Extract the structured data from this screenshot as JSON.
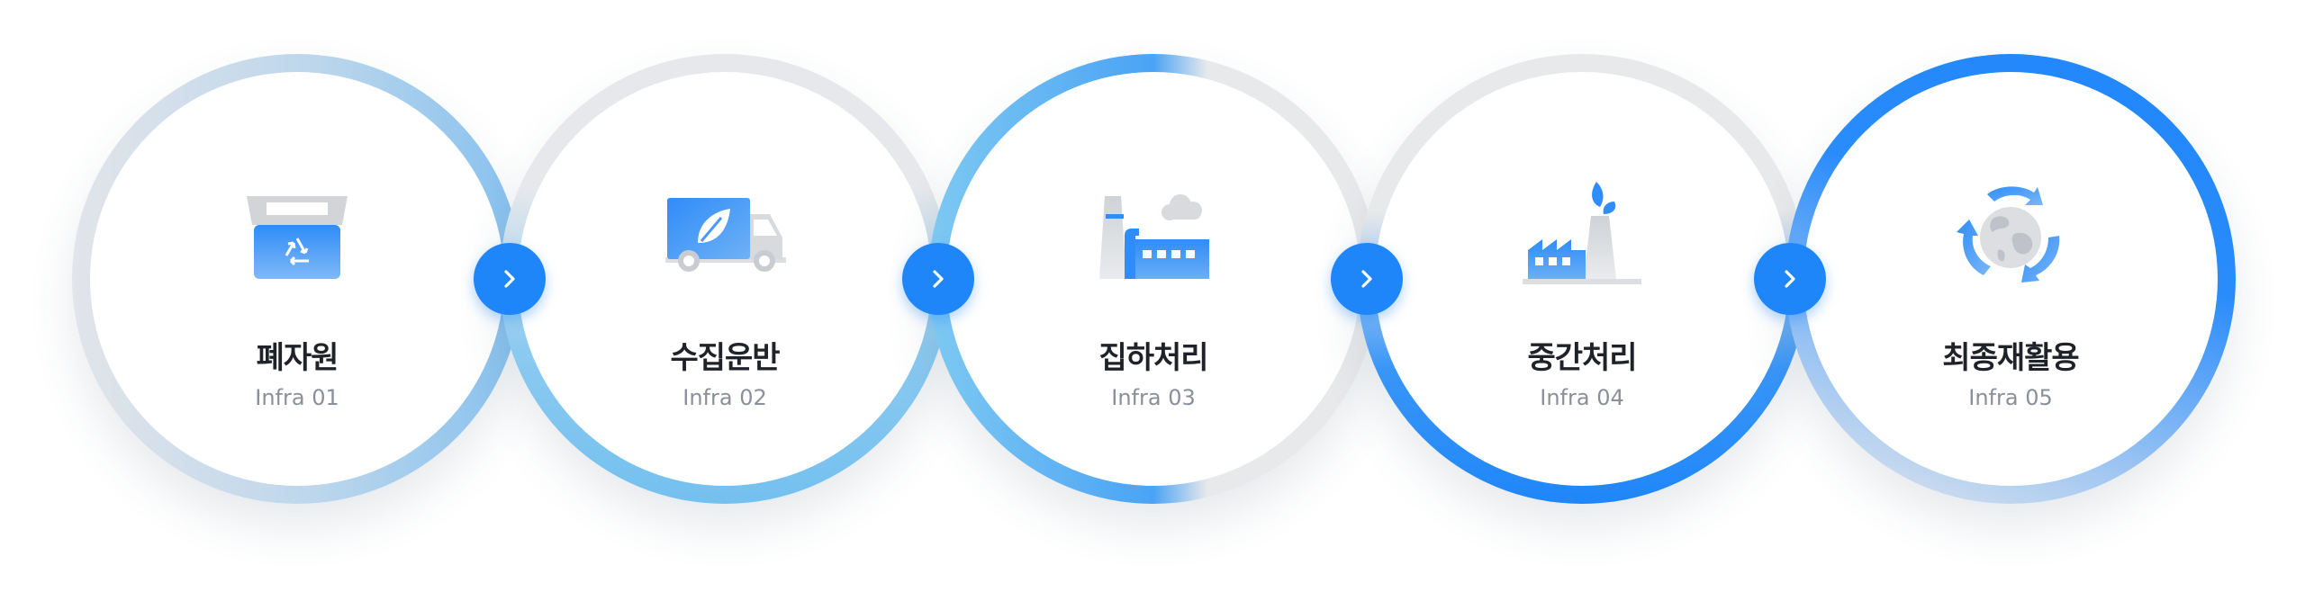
{
  "steps": [
    {
      "title": "폐자원",
      "subtitle": "Infra 01",
      "icon": "recycle-bin-icon"
    },
    {
      "title": "수집운반",
      "subtitle": "Infra 02",
      "icon": "truck-icon"
    },
    {
      "title": "집하처리",
      "subtitle": "Infra 03",
      "icon": "collection-plant-icon"
    },
    {
      "title": "중간처리",
      "subtitle": "Infra 04",
      "icon": "eco-factory-icon"
    },
    {
      "title": "최종재활용",
      "subtitle": "Infra 05",
      "icon": "globe-recycle-icon"
    }
  ],
  "arrows": [
    "chevron-right-icon",
    "chevron-right-icon",
    "chevron-right-icon",
    "chevron-right-icon"
  ],
  "colors": {
    "accent": "#1f86f9",
    "light_blue": "#74c0ef",
    "ring_gray": "#e6e8eb",
    "title_text": "#1f2329",
    "subtitle_text": "#8a9099"
  }
}
